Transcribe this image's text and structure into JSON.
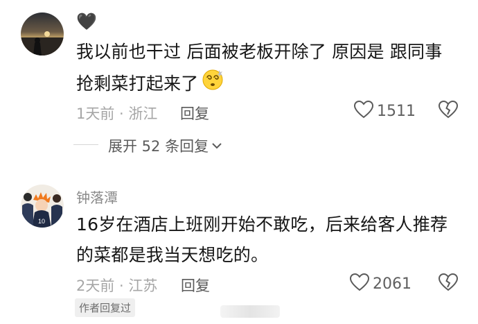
{
  "comment1": {
    "username_emoji": "🖤",
    "text_line1": "我以前也干过 后面被老板开除了 原因是 跟同事",
    "text_line2": "抢剩菜打起来了",
    "time_location": "1天前 · 浙江",
    "reply_label": "回复",
    "like_count": "1511",
    "expand_replies": "展开 52 条回复"
  },
  "comment2": {
    "username": "钟落潭",
    "text_line1": "16岁在酒店上班刚开始不敢吃，后来给客人推荐",
    "text_line2": "的菜都是我当天想吃的。",
    "time_location": "2天前 · 江苏",
    "reply_label": "回复",
    "like_count": "2061",
    "author_badge": "作者回复过"
  },
  "icons": {
    "like": "heart-outline-icon",
    "dislike": "broken-heart-icon",
    "expand": "chevron-down-icon",
    "emoji": "dizzy-face-emoji"
  }
}
